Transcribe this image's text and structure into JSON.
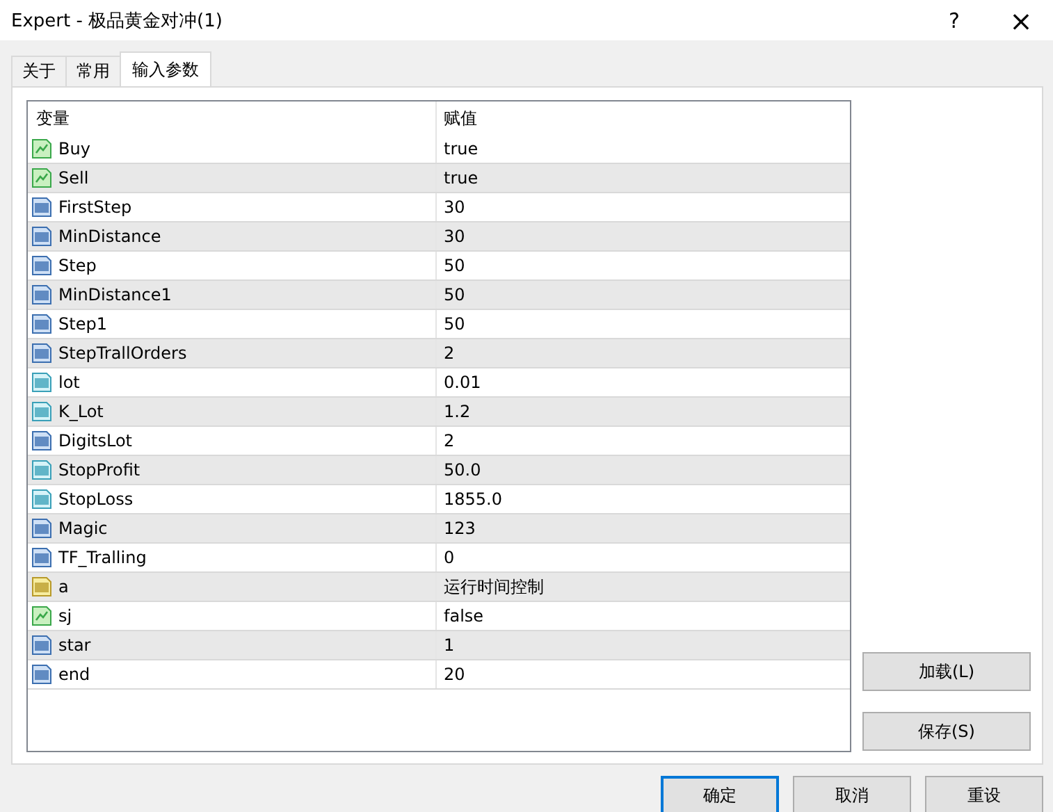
{
  "window": {
    "title": "Expert - 极品黄金对冲(1)",
    "help": "?",
    "close": "×"
  },
  "tabs": [
    {
      "label": "关于",
      "selected": false
    },
    {
      "label": "常用",
      "selected": false
    },
    {
      "label": "输入参数",
      "selected": true
    }
  ],
  "table": {
    "columns": [
      "变量",
      "赋值"
    ],
    "rows": [
      {
        "kind": "bool",
        "name": "Buy",
        "value": "true"
      },
      {
        "kind": "bool",
        "name": "Sell",
        "value": "true"
      },
      {
        "kind": "int",
        "name": "FirstStep",
        "value": "30"
      },
      {
        "kind": "int",
        "name": "MinDistance",
        "value": "30"
      },
      {
        "kind": "int",
        "name": "Step",
        "value": "50"
      },
      {
        "kind": "int",
        "name": "MinDistance1",
        "value": "50"
      },
      {
        "kind": "int",
        "name": "Step1",
        "value": "50"
      },
      {
        "kind": "int",
        "name": "StepTrallOrders",
        "value": "2"
      },
      {
        "kind": "double",
        "name": "lot",
        "value": "0.01"
      },
      {
        "kind": "double",
        "name": "K_Lot",
        "value": "1.2"
      },
      {
        "kind": "int",
        "name": "DigitsLot",
        "value": "2"
      },
      {
        "kind": "double",
        "name": "StopProfit",
        "value": "50.0"
      },
      {
        "kind": "double",
        "name": "StopLoss",
        "value": "1855.0"
      },
      {
        "kind": "int",
        "name": "Magic",
        "value": "123"
      },
      {
        "kind": "int",
        "name": "TF_Tralling",
        "value": "0"
      },
      {
        "kind": "string",
        "name": "a",
        "value": "运行时间控制"
      },
      {
        "kind": "bool",
        "name": "sj",
        "value": "false"
      },
      {
        "kind": "int",
        "name": "star",
        "value": "1"
      },
      {
        "kind": "int",
        "name": "end",
        "value": "20"
      }
    ]
  },
  "side_buttons": [
    "加载(L)",
    "保存(S)"
  ],
  "buttons": [
    {
      "label": "确定",
      "default": true
    },
    {
      "label": "取消",
      "default": false
    },
    {
      "label": "重设",
      "default": false
    }
  ]
}
